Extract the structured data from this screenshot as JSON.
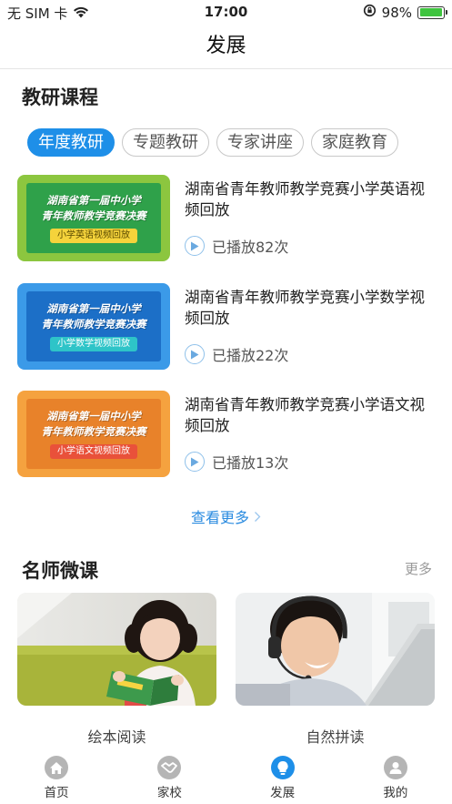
{
  "status_bar": {
    "carrier": "无 SIM 卡",
    "time": "17:00",
    "battery_percent": "98%",
    "battery_level": 0.98
  },
  "nav": {
    "title": "发展"
  },
  "research": {
    "title": "教研课程",
    "tabs": [
      {
        "label": "年度教研",
        "active": true
      },
      {
        "label": "专题教研",
        "active": false
      },
      {
        "label": "专家讲座",
        "active": false
      },
      {
        "label": "家庭教育",
        "active": false
      }
    ],
    "courses": [
      {
        "thumb_line1": "湖南省第一届中小学",
        "thumb_line2": "青年教师教学竞赛决赛",
        "thumb_badge": "小学英语视频回放",
        "title": "湖南省青年教师教学竞赛小学英语视频回放",
        "plays": "已播放82次",
        "outer_color": "#8cc63f",
        "inner_color": "#2fa14a",
        "badge_bg": "#f5d33b",
        "badge_fg": "#5a4a00"
      },
      {
        "thumb_line1": "湖南省第一届中小学",
        "thumb_line2": "青年教师教学竞赛决赛",
        "thumb_badge": "小学数学视频回放",
        "title": "湖南省青年教师教学竞赛小学数学视频回放",
        "plays": "已播放22次",
        "outer_color": "#3b9ae8",
        "inner_color": "#1c6fc7",
        "badge_bg": "#2ec4c8",
        "badge_fg": "#ffffff"
      },
      {
        "thumb_line1": "湖南省第一届中小学",
        "thumb_line2": "青年教师教学竞赛决赛",
        "thumb_badge": "小学语文视频回放",
        "title": "湖南省青年教师教学竞赛小学语文视频回放",
        "plays": "已播放13次",
        "outer_color": "#f5a23f",
        "inner_color": "#e8822a",
        "badge_bg": "#e9513a",
        "badge_fg": "#ffffff"
      }
    ],
    "more_label": "查看更多"
  },
  "micro": {
    "title": "名师微课",
    "more_label": "更多",
    "items": [
      {
        "label": "绘本阅读"
      },
      {
        "label": "自然拼读"
      }
    ]
  },
  "tab_bar": {
    "items": [
      {
        "label": "首页",
        "icon": "home-icon",
        "active": false
      },
      {
        "label": "家校",
        "icon": "handshake-icon",
        "active": false
      },
      {
        "label": "发展",
        "icon": "lightbulb-icon",
        "active": true
      },
      {
        "label": "我的",
        "icon": "user-icon",
        "active": false
      }
    ]
  },
  "colors": {
    "accent": "#1e8fe8",
    "link": "#2a8be0"
  }
}
